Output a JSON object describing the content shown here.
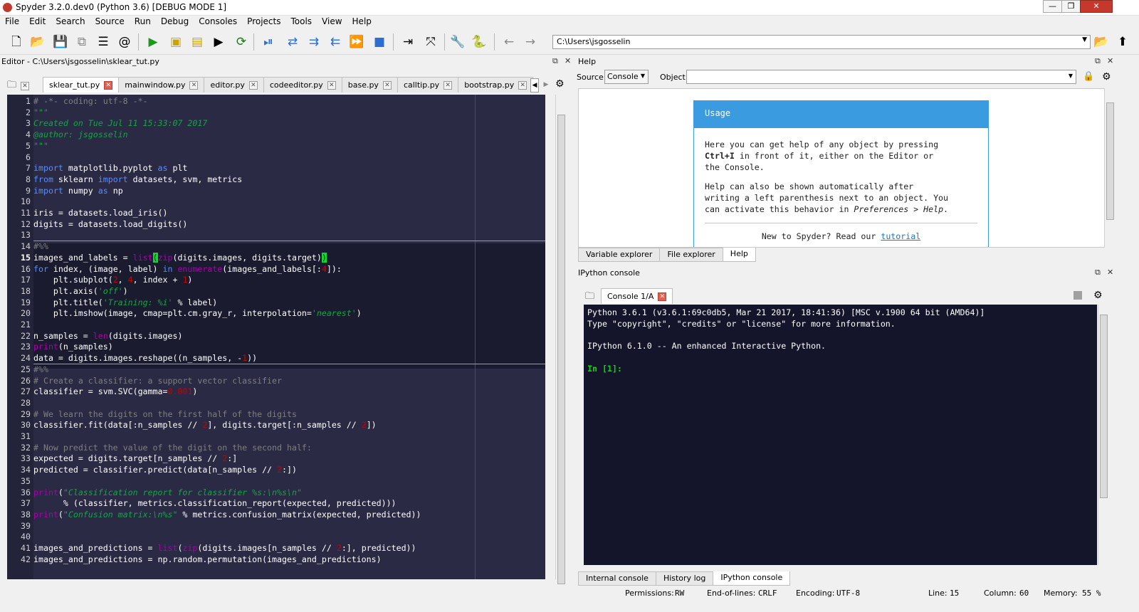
{
  "window": {
    "title": "Spyder 3.2.0.dev0 (Python 3.6) [DEBUG MODE 1]",
    "minimize": "—",
    "maximize": "❐",
    "close": "✕"
  },
  "menu": [
    "File",
    "Edit",
    "Search",
    "Source",
    "Run",
    "Debug",
    "Consoles",
    "Projects",
    "Tools",
    "View",
    "Help"
  ],
  "toolbar": {
    "path": "C:\\Users\\jsgosselin"
  },
  "editor": {
    "pane_title": "Editor - C:\\Users\\jsgosselin\\sklear_tut.py",
    "tabs": [
      {
        "label": "sklear_tut.py",
        "active": true
      },
      {
        "label": "mainwindow.py",
        "active": false
      },
      {
        "label": "editor.py",
        "active": false
      },
      {
        "label": "codeeditor.py",
        "active": false
      },
      {
        "label": "base.py",
        "active": false
      },
      {
        "label": "calltip.py",
        "active": false
      },
      {
        "label": "bootstrap.py",
        "active": false
      }
    ],
    "current_line": 15,
    "lines": [
      [
        {
          "t": "# -*- coding: utf-8 -*-",
          "c": "com"
        }
      ],
      [
        {
          "t": "\"\"\"",
          "c": "str"
        }
      ],
      [
        {
          "t": "Created on Tue Jul 11 15:33:07 2017",
          "c": "stri"
        }
      ],
      [
        {
          "t": "@author: jsgosselin",
          "c": "stri"
        }
      ],
      [
        {
          "t": "\"\"\"",
          "c": "str"
        }
      ],
      [],
      [
        {
          "t": "import",
          "c": "kw"
        },
        {
          "t": " matplotlib.pyplot ",
          "c": "n"
        },
        {
          "t": "as",
          "c": "kw"
        },
        {
          "t": " plt",
          "c": "n"
        }
      ],
      [
        {
          "t": "from",
          "c": "kw"
        },
        {
          "t": " sklearn ",
          "c": "n"
        },
        {
          "t": "import",
          "c": "kw"
        },
        {
          "t": " datasets, svm, metrics",
          "c": "n"
        }
      ],
      [
        {
          "t": "import",
          "c": "kw"
        },
        {
          "t": " numpy ",
          "c": "n"
        },
        {
          "t": "as",
          "c": "kw"
        },
        {
          "t": " np",
          "c": "n"
        }
      ],
      [],
      [
        {
          "t": "iris = datasets.load_iris()",
          "c": "n"
        }
      ],
      [
        {
          "t": "digits = datasets.load_digits()",
          "c": "n"
        }
      ],
      [],
      [
        {
          "t": "#%%",
          "c": "com"
        }
      ],
      [
        {
          "t": "images_and_labels = ",
          "c": "n"
        },
        {
          "t": "list",
          "c": "bi"
        },
        {
          "t": "(",
          "c": "hl"
        },
        {
          "t": "zip",
          "c": "bi"
        },
        {
          "t": "(digits.images, digits.target)",
          "c": "n"
        },
        {
          "t": ")",
          "c": "hl"
        }
      ],
      [
        {
          "t": "for",
          "c": "kw"
        },
        {
          "t": " index, (image, label) ",
          "c": "n"
        },
        {
          "t": "in",
          "c": "kw"
        },
        {
          "t": " ",
          "c": "n"
        },
        {
          "t": "enumerate",
          "c": "bi"
        },
        {
          "t": "(images_and_labels[:",
          "c": "n"
        },
        {
          "t": "4",
          "c": "num"
        },
        {
          "t": "]):",
          "c": "n"
        }
      ],
      [
        {
          "t": "    plt.subplot(",
          "c": "n"
        },
        {
          "t": "2",
          "c": "num"
        },
        {
          "t": ", ",
          "c": "n"
        },
        {
          "t": "4",
          "c": "num"
        },
        {
          "t": ", index + ",
          "c": "n"
        },
        {
          "t": "1",
          "c": "num"
        },
        {
          "t": ")",
          "c": "n"
        }
      ],
      [
        {
          "t": "    plt.axis(",
          "c": "n"
        },
        {
          "t": "'off'",
          "c": "stri"
        },
        {
          "t": ")",
          "c": "n"
        }
      ],
      [
        {
          "t": "    plt.title(",
          "c": "n"
        },
        {
          "t": "'Training: %i'",
          "c": "stri"
        },
        {
          "t": " % label)",
          "c": "n"
        }
      ],
      [
        {
          "t": "    plt.imshow(image, cmap=plt.cm.gray_r, interpolation=",
          "c": "n"
        },
        {
          "t": "'nearest'",
          "c": "stri"
        },
        {
          "t": ")",
          "c": "n"
        }
      ],
      [],
      [
        {
          "t": "n_samples = ",
          "c": "n"
        },
        {
          "t": "len",
          "c": "bi"
        },
        {
          "t": "(digits.images)",
          "c": "n"
        }
      ],
      [
        {
          "t": "print",
          "c": "bi"
        },
        {
          "t": "(n_samples)",
          "c": "n"
        }
      ],
      [
        {
          "t": "data = digits.images.reshape((n_samples, -",
          "c": "n"
        },
        {
          "t": "1",
          "c": "num"
        },
        {
          "t": "))",
          "c": "n"
        }
      ],
      [
        {
          "t": "#%%",
          "c": "com"
        }
      ],
      [
        {
          "t": "# Create a classifier: a support vector classifier",
          "c": "com"
        }
      ],
      [
        {
          "t": "classifier = svm.SVC(gamma=",
          "c": "n"
        },
        {
          "t": "0.001",
          "c": "num"
        },
        {
          "t": ")",
          "c": "n"
        }
      ],
      [],
      [
        {
          "t": "# We learn the digits on the first half of the digits",
          "c": "com"
        }
      ],
      [
        {
          "t": "classifier.fit(data[:n_samples // ",
          "c": "n"
        },
        {
          "t": "2",
          "c": "num"
        },
        {
          "t": "], digits.target[:n_samples // ",
          "c": "n"
        },
        {
          "t": "2",
          "c": "num"
        },
        {
          "t": "])",
          "c": "n"
        }
      ],
      [],
      [
        {
          "t": "# Now predict the value of the digit on the second half:",
          "c": "com"
        }
      ],
      [
        {
          "t": "expected = digits.target[n_samples // ",
          "c": "n"
        },
        {
          "t": "2",
          "c": "num"
        },
        {
          "t": ":]",
          "c": "n"
        }
      ],
      [
        {
          "t": "predicted = classifier.predict(data[n_samples // ",
          "c": "n"
        },
        {
          "t": "2",
          "c": "num"
        },
        {
          "t": ":])",
          "c": "n"
        }
      ],
      [],
      [
        {
          "t": "print",
          "c": "bi"
        },
        {
          "t": "(",
          "c": "n"
        },
        {
          "t": "\"Classification report for classifier %s:\\n%s\\n\"",
          "c": "stri"
        }
      ],
      [
        {
          "t": "      % (classifier, metrics.classification_report(expected, predicted)))",
          "c": "n"
        }
      ],
      [
        {
          "t": "print",
          "c": "bi"
        },
        {
          "t": "(",
          "c": "n"
        },
        {
          "t": "\"Confusion matrix:\\n%s\"",
          "c": "stri"
        },
        {
          "t": " % metrics.confusion_matrix(expected, predicted))",
          "c": "n"
        }
      ],
      [],
      [],
      [
        {
          "t": "images_and_predictions = ",
          "c": "n"
        },
        {
          "t": "list",
          "c": "bi"
        },
        {
          "t": "(",
          "c": "n"
        },
        {
          "t": "zip",
          "c": "bi"
        },
        {
          "t": "(digits.images[n_samples // ",
          "c": "n"
        },
        {
          "t": "2",
          "c": "num"
        },
        {
          "t": ":], predicted))",
          "c": "n"
        }
      ],
      [
        {
          "t": "images_and_predictions = np.random.permutation(images_and_predictions)",
          "c": "n"
        }
      ]
    ]
  },
  "help": {
    "pane_title": "Help",
    "source_label": "Source",
    "source_value": "Console",
    "object_label": "Object",
    "usage_title": "Usage",
    "usage_p1_a": "Here you can get help of any object by pressing",
    "usage_p1_b": "Ctrl+I",
    "usage_p1_c": " in front of it, either on the Editor or",
    "usage_p1_d": "the Console.",
    "usage_p2_a": "Help can also be shown automatically after",
    "usage_p2_b": "writing a left parenthesis next to an object. You",
    "usage_p2_c": "can activate this behavior in ",
    "usage_p2_d": "Preferences > Help",
    "usage_p2_e": ".",
    "usage_new": "New to Spyder? Read our ",
    "usage_link": "tutorial",
    "tabs": [
      "Variable explorer",
      "File explorer",
      "Help"
    ]
  },
  "console": {
    "pane_title": "IPython console",
    "tab_label": "Console 1/A",
    "lines": [
      "Python 3.6.1 (v3.6.1:69c0db5, Mar 21 2017, 18:41:36) [MSC v.1900 64 bit (AMD64)]",
      "Type \"copyright\", \"credits\" or \"license\" for more information.",
      "",
      "IPython 6.1.0 -- An enhanced Interactive Python.",
      "",
      "In [1]:"
    ],
    "tabs": [
      "Internal console",
      "History log",
      "IPython console"
    ]
  },
  "status": {
    "permissions_label": "Permissions:",
    "permissions_value": "RW",
    "eol_label": "End-of-lines:",
    "eol_value": "CRLF",
    "encoding_label": "Encoding:",
    "encoding_value": "UTF-8",
    "line_label": "Line:",
    "line_value": "15",
    "column_label": "Column:",
    "column_value": "60",
    "memory_label": "Memory:",
    "memory_value": "55 %"
  },
  "colors": {
    "editor_bg": "#2a2a45",
    "cell_highlight": "#1b1b30",
    "keyword": "#558eff",
    "builtin": "#aa00aa",
    "string": "#11a642",
    "comment": "#7f7f7f",
    "number": "#c80000",
    "bracket_match": "#0dd92f",
    "accent_blue": "#3b9be0"
  }
}
